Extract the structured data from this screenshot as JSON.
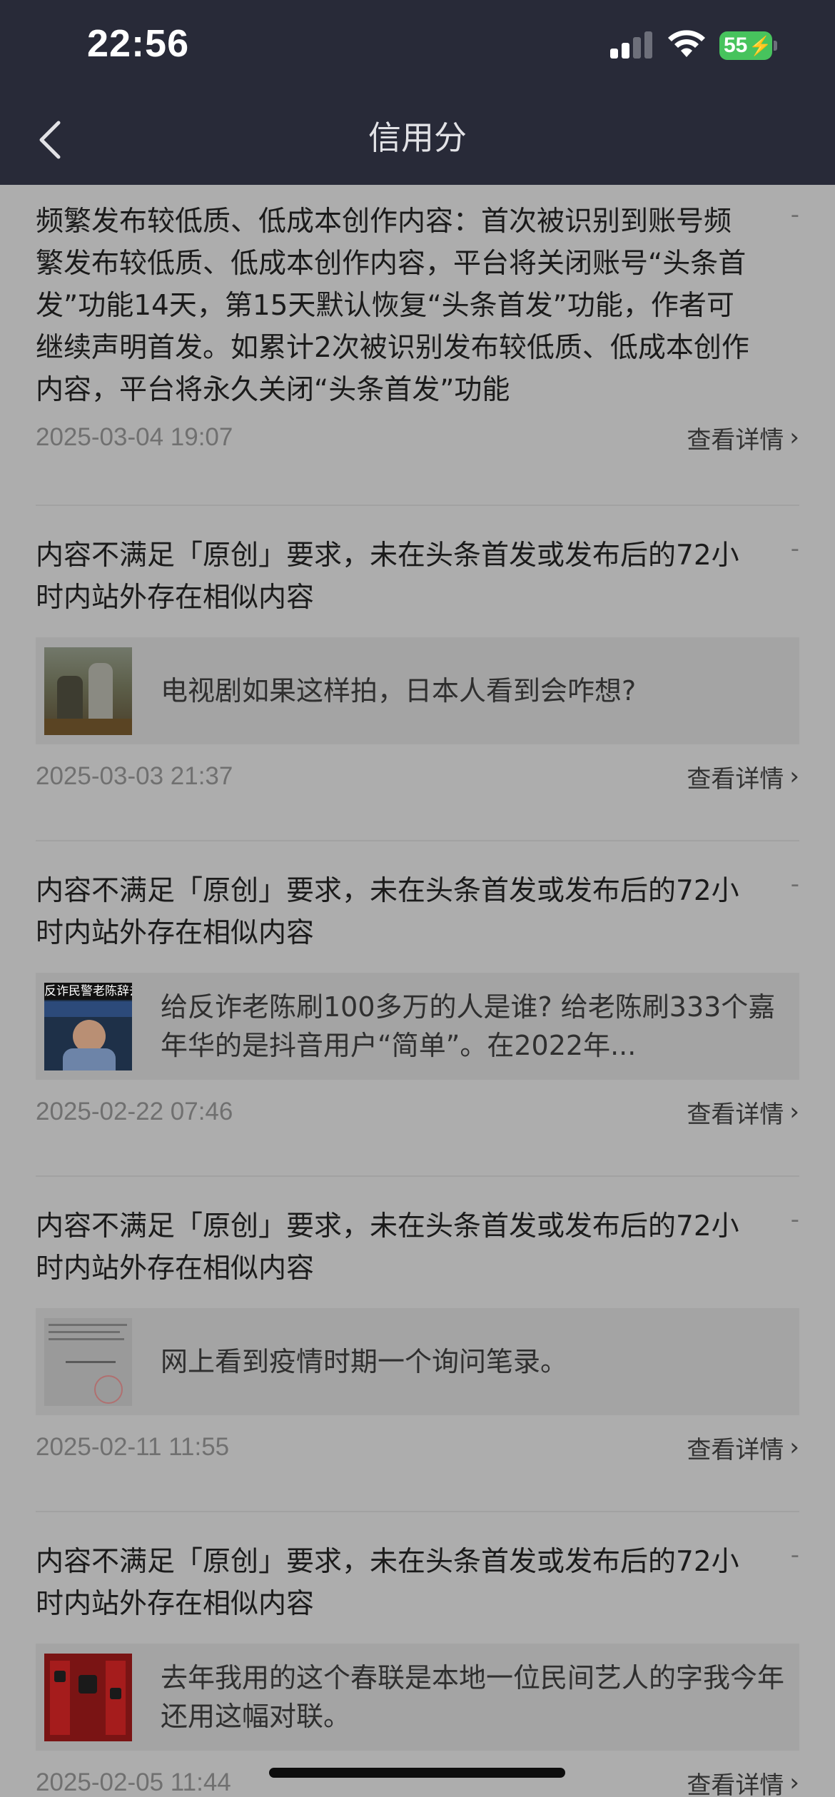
{
  "status_bar": {
    "time": "22:56",
    "battery": "55"
  },
  "nav": {
    "title": "信用分",
    "back_icon": "chevron-left-icon"
  },
  "items": [
    {
      "title": "频繁发布较低质、低成本创作内容：首次被识别到账号频繁发布较低质、低成本创作内容，平台将关闭账号“头条首发”功能14天，第15天默认恢复“头条首发”功能，作者可继续声明首发。如累计2次被识别发布较低质、低成本创作内容，平台将永久关闭“头条首发”功能",
      "score": "-",
      "date": "2025-03-04 19:07",
      "detail": "查看详情"
    },
    {
      "title": "内容不满足「原创」要求，未在头条首发或发布后的72小时内站外存在相似内容",
      "score": "-",
      "preview": "电视剧如果这样拍，日本人看到会咋想?",
      "date": "2025-03-03 21:37",
      "detail": "查看详情"
    },
    {
      "title": "内容不满足「原创」要求，未在头条首发或发布后的72小时内站外存在相似内容",
      "score": "-",
      "preview": "给反诈老陈刷100多万的人是谁?  给老陈刷333个嘉年华的是抖音用户“简单”。在2022年...",
      "thumb_caption": "反诈民警老陈辞去公职",
      "date": "2025-02-22 07:46",
      "detail": "查看详情"
    },
    {
      "title": "内容不满足「原创」要求，未在头条首发或发布后的72小时内站外存在相似内容",
      "score": "-",
      "preview": "网上看到疫情时期一个询问笔录。",
      "date": "2025-02-11 11:55",
      "detail": "查看详情"
    },
    {
      "title": "内容不满足「原创」要求，未在头条首发或发布后的72小时内站外存在相似内容",
      "score": "-",
      "preview": "去年我用的这个春联是本地一位民间艺人的字我今年还用这幅对联。",
      "date": "2025-02-05 11:44",
      "detail": "查看详情"
    }
  ]
}
